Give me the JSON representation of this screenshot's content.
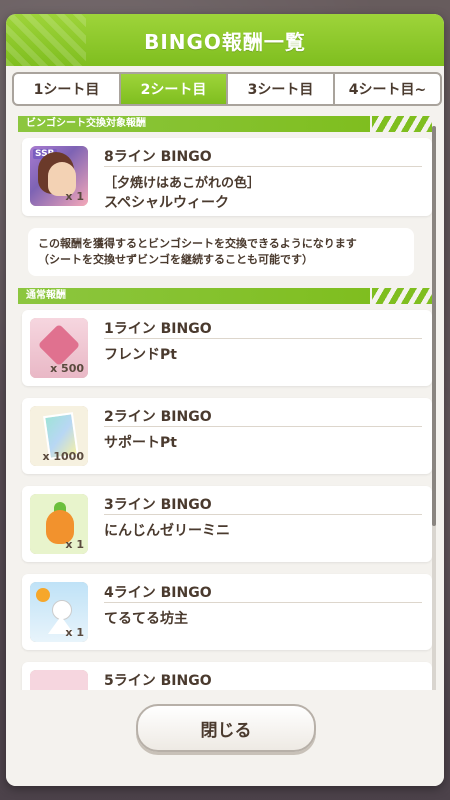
{
  "dialog": {
    "title": "BINGO報酬一覧"
  },
  "tabs": [
    {
      "label": "1シート目",
      "active": false
    },
    {
      "label": "2シート目",
      "active": true
    },
    {
      "label": "3シート目",
      "active": false
    },
    {
      "label": "4シート目~",
      "active": false
    }
  ],
  "sections": {
    "exchange": "ビンゴシート交換対象報酬",
    "normal": "通常報酬"
  },
  "exchange_reward": {
    "line": "8ライン BINGO",
    "sub": "［夕焼けはあこがれの色］",
    "name": "スペシャルウィーク",
    "badge": "SSR",
    "qty": "x 1"
  },
  "note": {
    "line1": "この報酬を獲得するとビンゴシートを交換できるようになります",
    "line2": "（シートを交換せずビンゴを継続することも可能です）"
  },
  "rewards": [
    {
      "line": "1ライン BINGO",
      "name": "フレンドPt",
      "qty": "x 500",
      "icon": "friend-point-icon"
    },
    {
      "line": "2ライン BINGO",
      "name": "サポートPt",
      "qty": "x 1000",
      "icon": "support-point-icon"
    },
    {
      "line": "3ライン BINGO",
      "name": "にんじんゼリーミニ",
      "qty": "x 1",
      "icon": "carrot-jelly-icon"
    },
    {
      "line": "4ライン BINGO",
      "name": "てるてる坊主",
      "qty": "x 1",
      "icon": "teru-teru-bozu-icon"
    },
    {
      "line": "5ライン BINGO",
      "name": "",
      "qty": "",
      "icon": "reward-item-icon"
    }
  ],
  "footer": {
    "close_label": "閉じる"
  },
  "colors": {
    "header_green": "#7fbe1f",
    "text_brown": "#4a3a2e"
  }
}
